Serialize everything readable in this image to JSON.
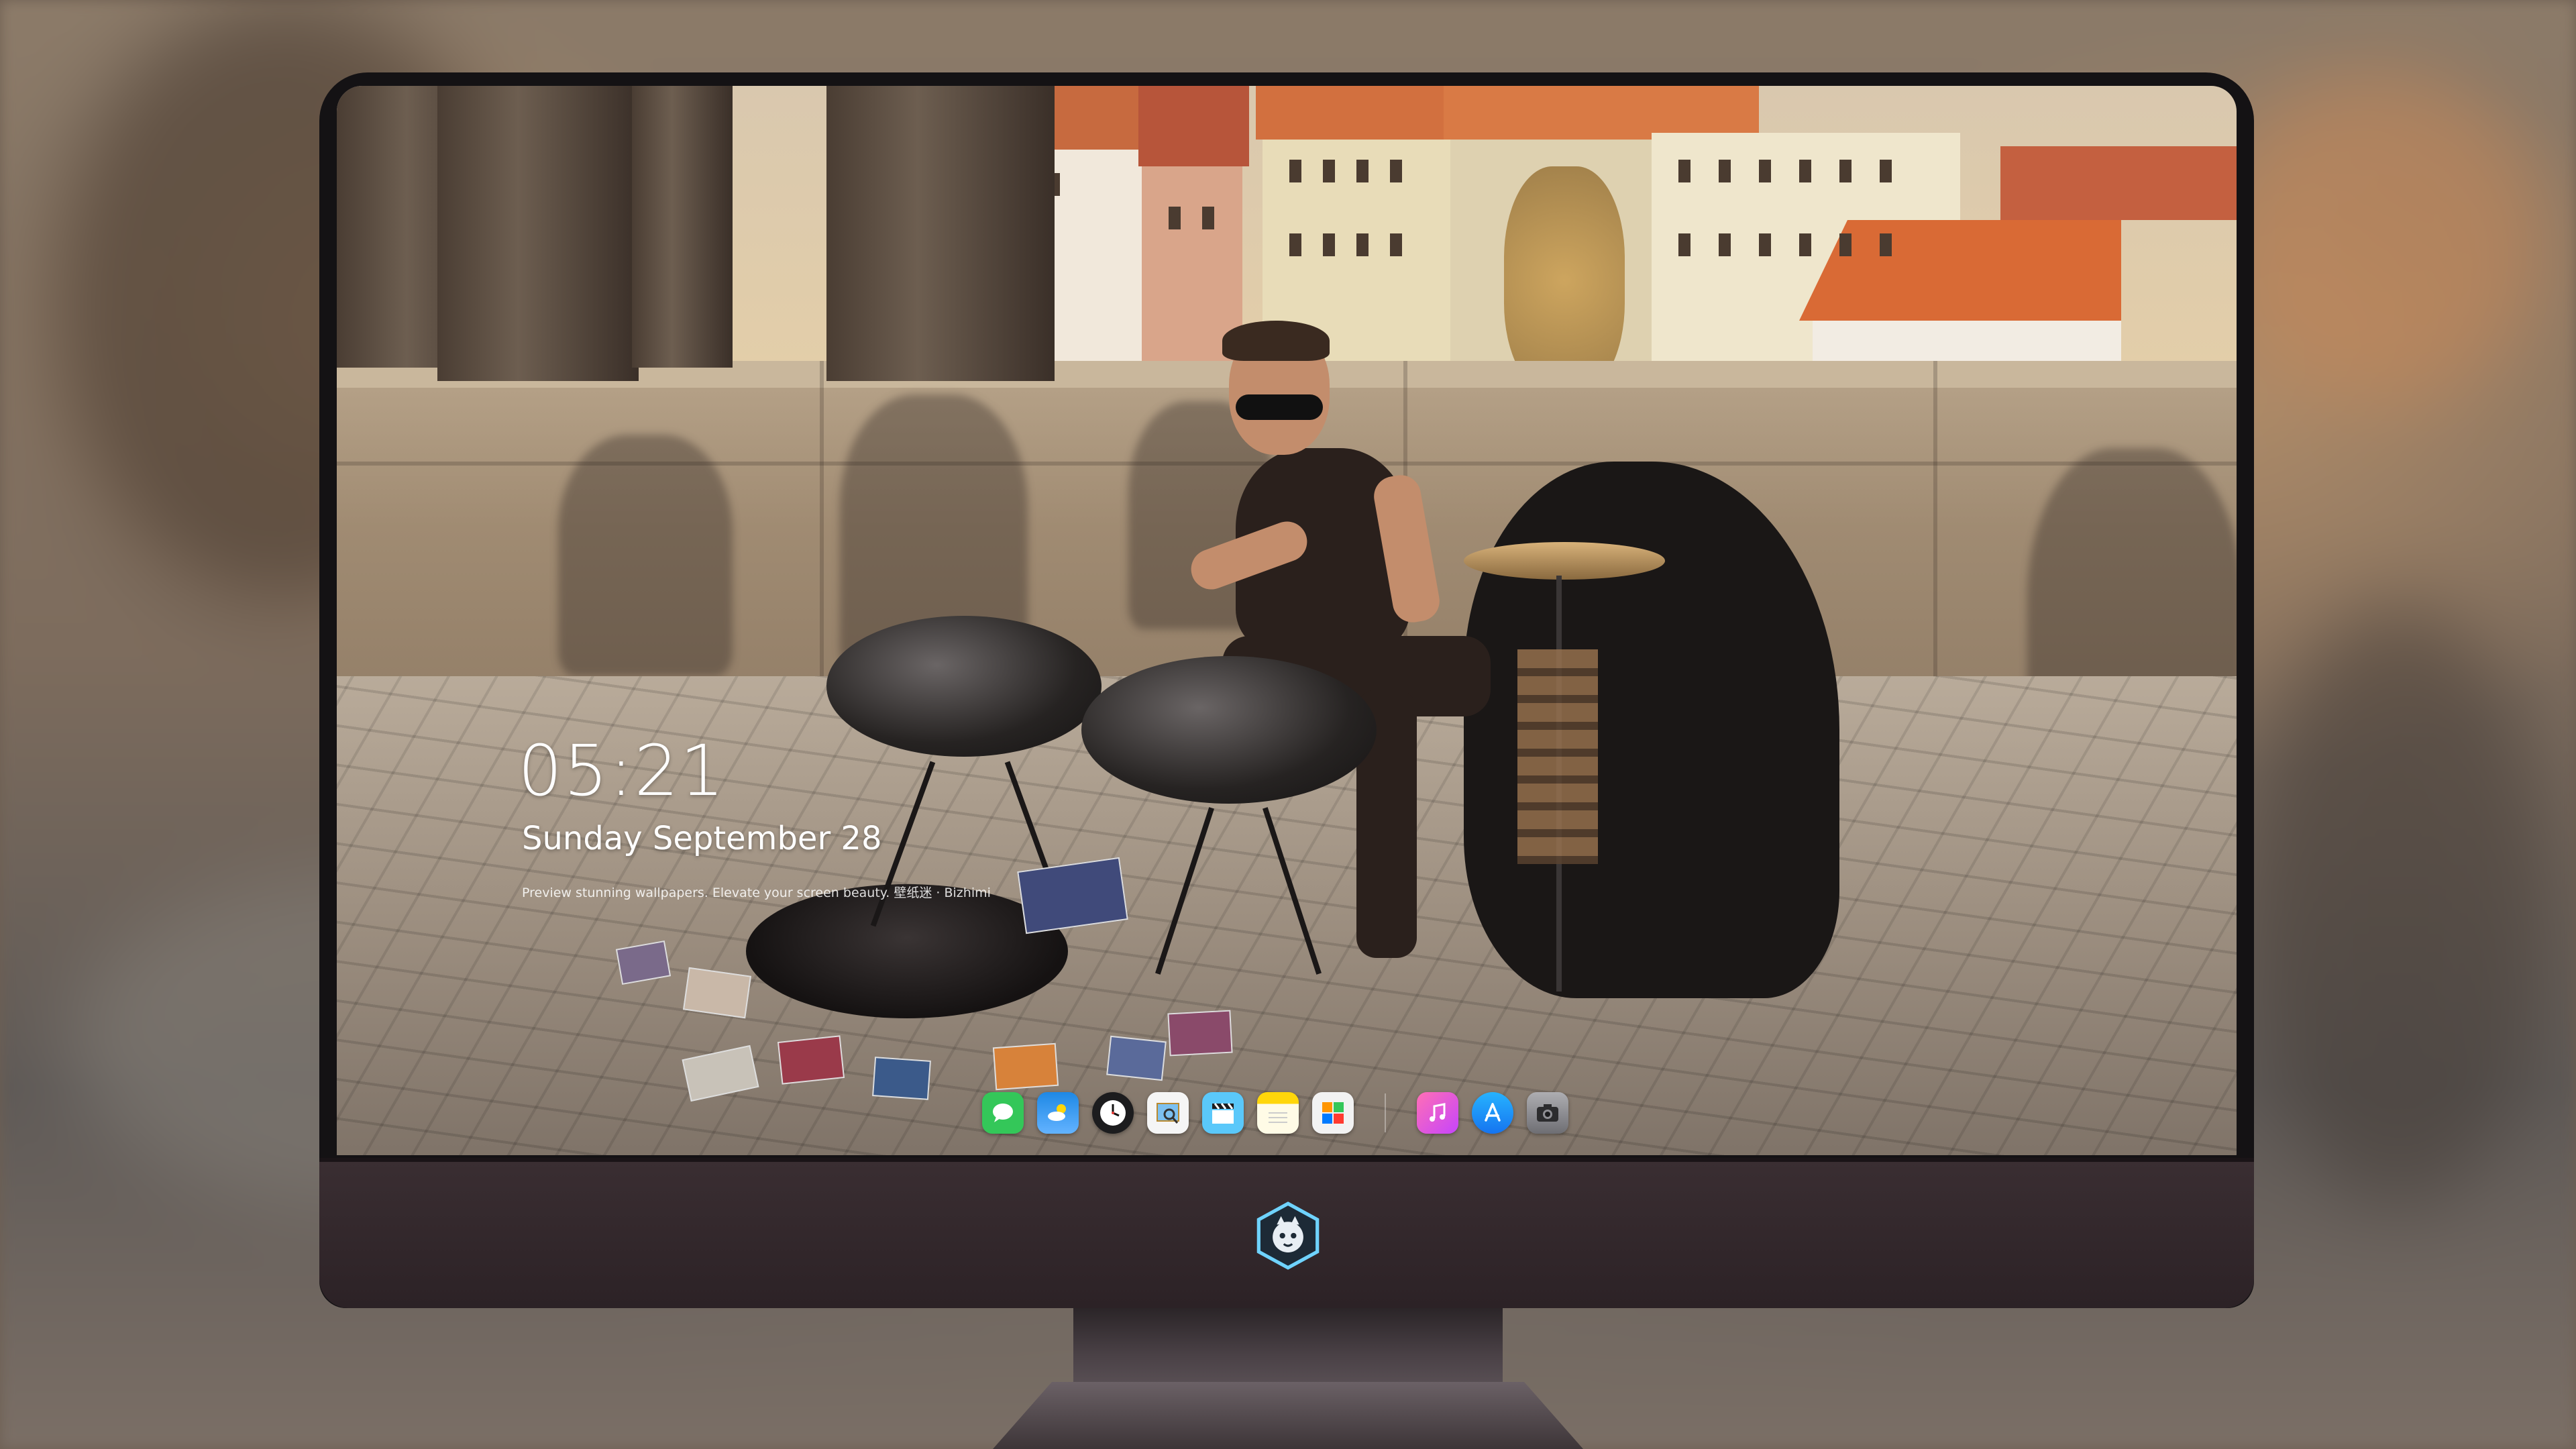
{
  "overlay": {
    "time": "05:21",
    "date": "Sunday September  28",
    "tagline": "Preview stunning wallpapers. Elevate your screen beauty. 壁纸迷 · Bizhimi"
  },
  "dock": {
    "apps": [
      {
        "name": "messages-icon",
        "color": "#34c759"
      },
      {
        "name": "weather-icon",
        "color": "#1e88e5"
      },
      {
        "name": "clock-icon",
        "color": "#1c1c1e"
      },
      {
        "name": "preview-icon",
        "color": "#ffffff"
      },
      {
        "name": "clips-icon",
        "color": "#5ac8fa"
      },
      {
        "name": "notes-icon",
        "color": "#ffd60a"
      },
      {
        "name": "photo-booth-icon",
        "color": "#f2f2f2"
      },
      {
        "name": "itunes-icon",
        "color": "#ea4c89"
      },
      {
        "name": "app-store-icon",
        "color": "#1e90ff"
      },
      {
        "name": "camera-icon",
        "color": "#8e8e93"
      }
    ]
  },
  "colors": {
    "monitor_bezel": "#141214",
    "monitor_chin": "#3a2e32",
    "text": "#ffffff"
  }
}
